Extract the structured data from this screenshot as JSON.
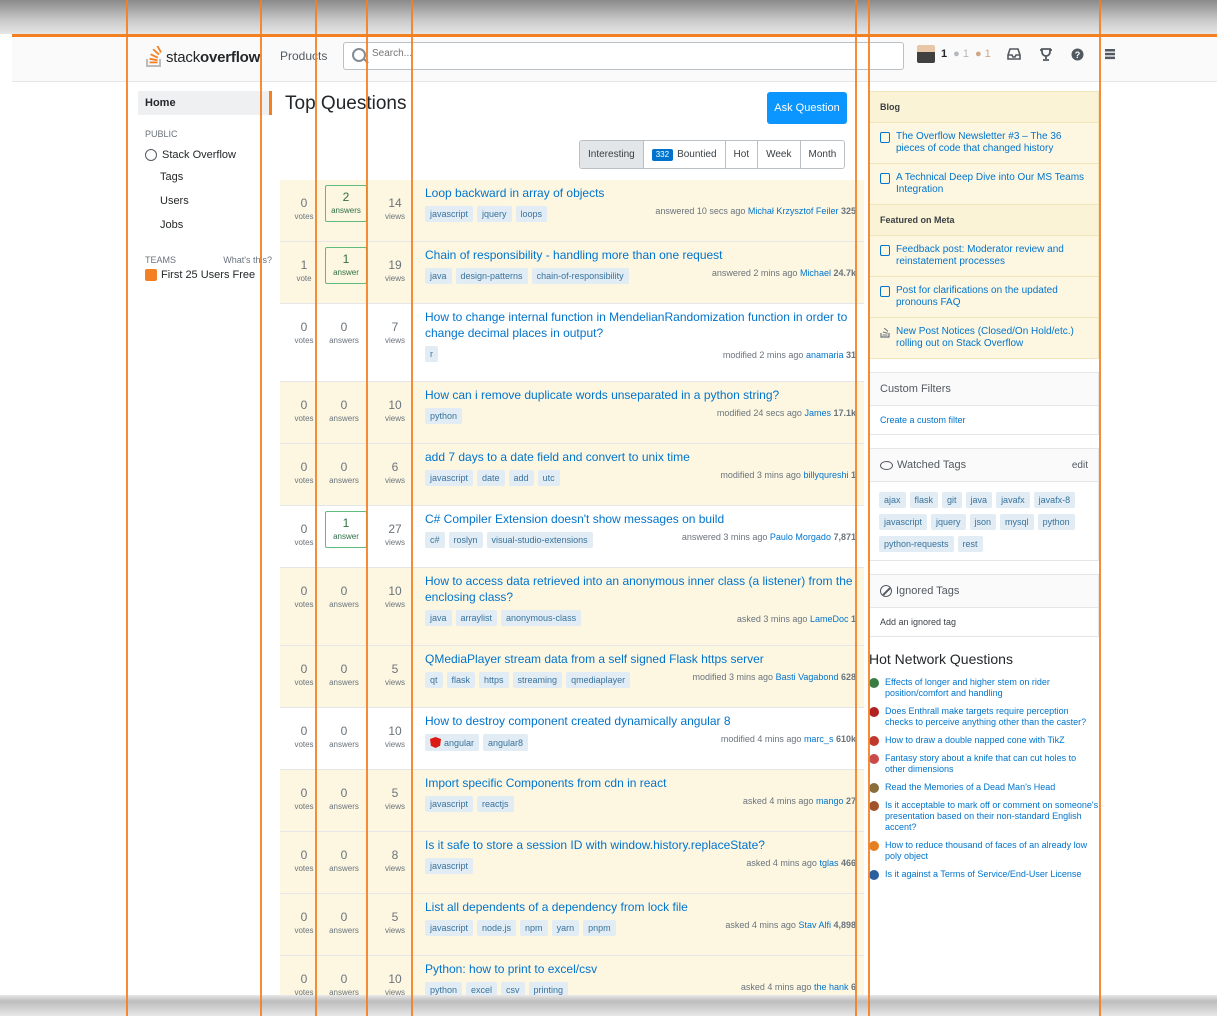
{
  "logo": {
    "word1": "stack",
    "word2": "overflow"
  },
  "topbar": {
    "products": "Products",
    "search_placeholder": "Search...",
    "reputation": "1",
    "silver": "● 1",
    "bronze": "● 1"
  },
  "leftnav": {
    "home": "Home",
    "public_label": "PUBLIC",
    "stack_overflow": "Stack Overflow",
    "tags": "Tags",
    "users": "Users",
    "jobs": "Jobs",
    "teams_label": "TEAMS",
    "whats_this": "What's this?",
    "teams_item": "First 25 Users Free"
  },
  "main": {
    "title": "Top Questions",
    "ask_button": "Ask Question",
    "filters": {
      "interesting": "Interesting",
      "bounty_count": "332",
      "bountied": "Bountied",
      "hot": "Hot",
      "week": "Week",
      "month": "Month"
    }
  },
  "questions": [
    {
      "votes": "0",
      "votes_lbl": "votes",
      "answers": "2",
      "answers_lbl": "answers",
      "views": "14",
      "views_lbl": "views",
      "title": "Loop backward in array of objects",
      "tags": [
        "javascript",
        "jquery",
        "loops"
      ],
      "action": "answered 10 secs ago",
      "user": "Michał Krzysztof Feiler",
      "rep": "325"
    },
    {
      "votes": "1",
      "votes_lbl": "vote",
      "answers": "1",
      "answers_lbl": "answer",
      "views": "19",
      "views_lbl": "views",
      "title": "Chain of responsibility - handling more than one request",
      "tags": [
        "java",
        "design-patterns",
        "chain-of-responsibility"
      ],
      "action": "answered 2 mins ago",
      "user": "Michael",
      "rep": "24.7k"
    },
    {
      "votes": "0",
      "votes_lbl": "votes",
      "answers": "0",
      "answers_lbl": "answers",
      "views": "7",
      "views_lbl": "views",
      "title": "How to change internal function in MendelianRandomization function in order to change decimal places in output?",
      "tags": [
        "r"
      ],
      "action": "modified 2 mins ago",
      "user": "anamaria",
      "rep": "31"
    },
    {
      "votes": "0",
      "votes_lbl": "votes",
      "answers": "0",
      "answers_lbl": "answers",
      "views": "10",
      "views_lbl": "views",
      "title": "How can i remove duplicate words unseparated in a python string?",
      "tags": [
        "python"
      ],
      "action": "modified 24 secs ago",
      "user": "James",
      "rep": "17.1k"
    },
    {
      "votes": "0",
      "votes_lbl": "votes",
      "answers": "0",
      "answers_lbl": "answers",
      "views": "6",
      "views_lbl": "views",
      "title": "add 7 days to a date field and convert to unix time",
      "tags": [
        "javascript",
        "date",
        "add",
        "utc"
      ],
      "action": "modified 3 mins ago",
      "user": "billyqureshi",
      "rep": "1"
    },
    {
      "votes": "0",
      "votes_lbl": "votes",
      "answers": "1",
      "answers_lbl": "answer",
      "views": "27",
      "views_lbl": "views",
      "title": "C# Compiler Extension doesn't show messages on build",
      "tags": [
        "c#",
        "roslyn",
        "visual-studio-extensions"
      ],
      "action": "answered 3 mins ago",
      "user": "Paulo Morgado",
      "rep": "7,871"
    },
    {
      "votes": "0",
      "votes_lbl": "votes",
      "answers": "0",
      "answers_lbl": "answers",
      "views": "10",
      "views_lbl": "views",
      "title": "How to access data retrieved into an anonymous inner class (a listener) from the enclosing class?",
      "tags": [
        "java",
        "arraylist",
        "anonymous-class"
      ],
      "action": "asked 3 mins ago",
      "user": "LameDoc",
      "rep": "1"
    },
    {
      "votes": "0",
      "votes_lbl": "votes",
      "answers": "0",
      "answers_lbl": "answers",
      "views": "5",
      "views_lbl": "views",
      "title": "QMediaPlayer stream data from a self signed Flask https server",
      "tags": [
        "qt",
        "flask",
        "https",
        "streaming",
        "qmediaplayer"
      ],
      "action": "modified 3 mins ago",
      "user": "Basti Vagabond",
      "rep": "628"
    },
    {
      "votes": "0",
      "votes_lbl": "votes",
      "answers": "0",
      "answers_lbl": "answers",
      "views": "10",
      "views_lbl": "views",
      "title": "How to destroy component created dynamically angular 8",
      "tags": [
        "angular",
        "angular8"
      ],
      "action": "modified 4 mins ago",
      "user": "marc_s",
      "rep": "610k"
    },
    {
      "votes": "0",
      "votes_lbl": "votes",
      "answers": "0",
      "answers_lbl": "answers",
      "views": "5",
      "views_lbl": "views",
      "title": "Import specific Components from cdn in react",
      "tags": [
        "javascript",
        "reactjs"
      ],
      "action": "asked 4 mins ago",
      "user": "mango",
      "rep": "27"
    },
    {
      "votes": "0",
      "votes_lbl": "votes",
      "answers": "0",
      "answers_lbl": "answers",
      "views": "8",
      "views_lbl": "views",
      "title": "Is it safe to store a session ID with window.history.replaceState?",
      "tags": [
        "javascript"
      ],
      "action": "asked 4 mins ago",
      "user": "tglas",
      "rep": "466"
    },
    {
      "votes": "0",
      "votes_lbl": "votes",
      "answers": "0",
      "answers_lbl": "answers",
      "views": "5",
      "views_lbl": "views",
      "title": "List all dependents of a dependency from lock file",
      "tags": [
        "javascript",
        "node.js",
        "npm",
        "yarn",
        "pnpm"
      ],
      "action": "asked 4 mins ago",
      "user": "Stav Alfi",
      "rep": "4,898"
    },
    {
      "votes": "0",
      "votes_lbl": "votes",
      "answers": "0",
      "answers_lbl": "answers",
      "views": "10",
      "views_lbl": "views",
      "title": "Python: how to print to excel/csv",
      "tags": [
        "python",
        "excel",
        "csv",
        "printing"
      ],
      "action": "asked 4 mins ago",
      "user": "the hank",
      "rep": "6"
    }
  ],
  "sidebar": {
    "blog_header": "Blog",
    "blog_items": [
      "The Overflow Newsletter #3 – The 36 pieces of code that changed history",
      "A Technical Deep Dive into Our MS Teams Integration"
    ],
    "meta_header": "Featured on Meta",
    "meta_items": [
      "Feedback post: Moderator review and reinstatement processes",
      "Post for clarifications on the updated pronouns FAQ",
      "New Post Notices (Closed/On Hold/etc.) rolling out on Stack Overflow"
    ],
    "custom_filters": "Custom Filters",
    "create_filter": "Create a custom filter",
    "watched_tags": "Watched Tags",
    "edit": "edit",
    "watched": [
      "ajax",
      "flask",
      "git",
      "java",
      "javafx",
      "javafx-8",
      "javascript",
      "jquery",
      "json",
      "mysql",
      "python",
      "python-requests",
      "rest"
    ],
    "ignored_tags": "Ignored Tags",
    "add_ignored": "Add an ignored tag",
    "hnq_title": "Hot Network Questions",
    "hnq": [
      {
        "text": "Effects of longer and higher stem on rider position/comfort and handling",
        "color": "#3a7d44"
      },
      {
        "text": "Does Enthrall make targets require perception checks to perceive anything other than the caster?",
        "color": "#b22222"
      },
      {
        "text": "How to draw a double napped cone with TikZ",
        "color": "#c0392b"
      },
      {
        "text": "Fantasy story about a knife that can cut holes to other dimensions",
        "color": "#c94b4b"
      },
      {
        "text": "Read the Memories of a Dead Man's Head",
        "color": "#8a6d3b"
      },
      {
        "text": "Is it acceptable to mark off or comment on someone's presentation based on their non-standard English accent?",
        "color": "#a0522d"
      },
      {
        "text": "How to reduce thousand of faces of an already low poly object",
        "color": "#e67e22"
      },
      {
        "text": "Is it against a Terms of Service/End-User License",
        "color": "#2c5f9e"
      }
    ]
  },
  "colors": {
    "accent": "#f48024",
    "link": "#0074cc",
    "button": "#0a95ff",
    "answered": "#5eba7d"
  }
}
